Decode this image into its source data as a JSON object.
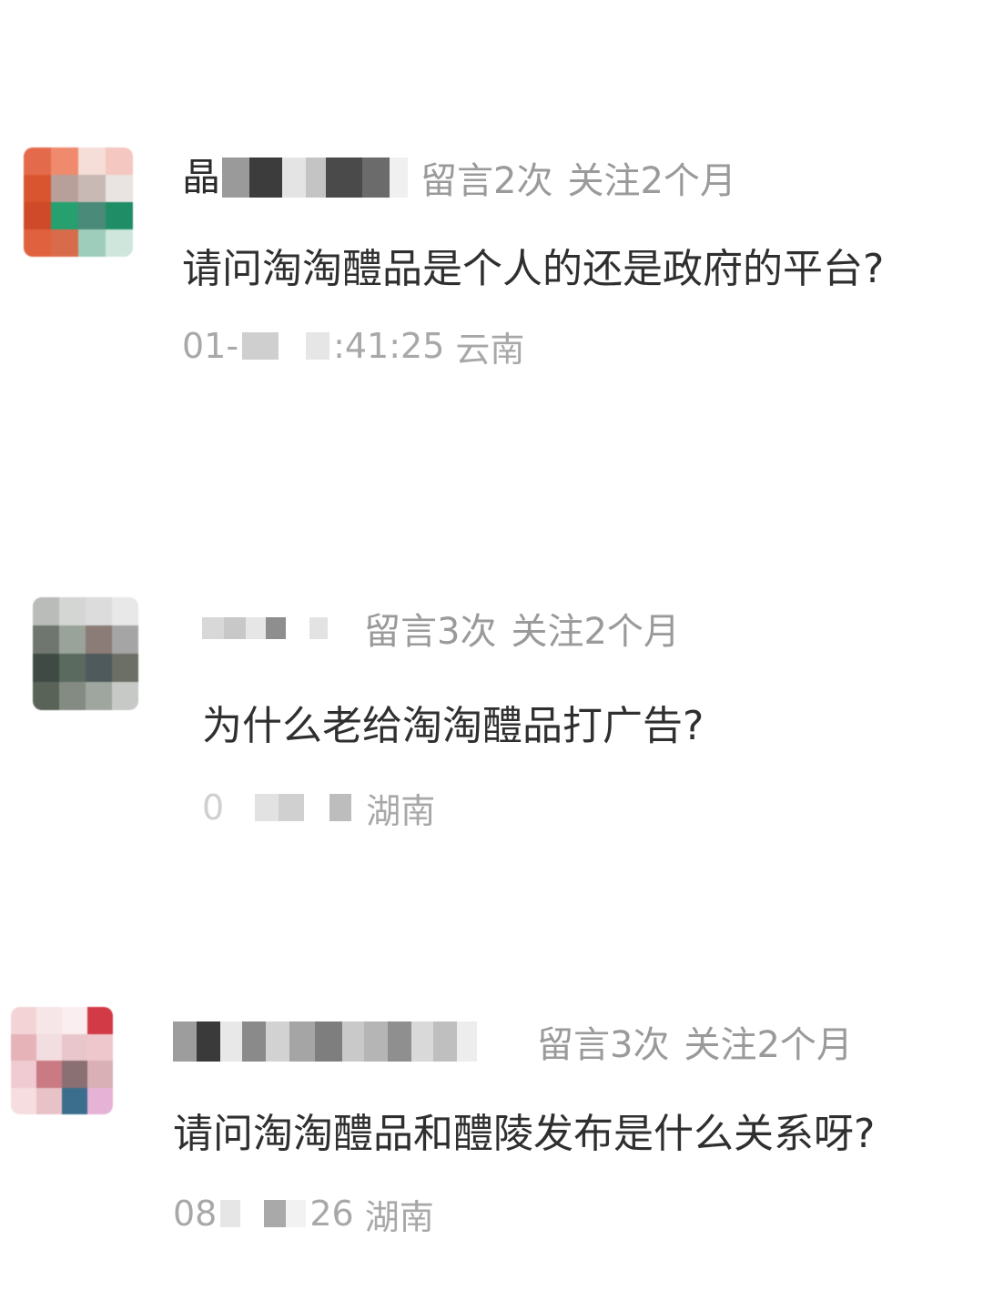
{
  "comments": [
    {
      "name_visible": "晶",
      "stats_messages": "留言2次",
      "stats_follow": "关注2个月",
      "content": "请问淘淘醴品是个人的还是政府的平台?",
      "time_prefix": "01-",
      "time_suffix": ":41:25",
      "location": "云南"
    },
    {
      "name_visible": "",
      "stats_messages": "留言3次",
      "stats_follow": "关注2个月",
      "content": "为什么老给淘淘醴品打广告?",
      "time_prefix": "0",
      "time_suffix": "",
      "location": "湖南"
    },
    {
      "name_visible": "",
      "stats_messages": "留言3次",
      "stats_follow": "关注2个月",
      "content": "请问淘淘醴品和醴陵发布是什么关系呀?",
      "time_prefix": "08",
      "time_suffix": "26",
      "location": "湖南"
    }
  ]
}
